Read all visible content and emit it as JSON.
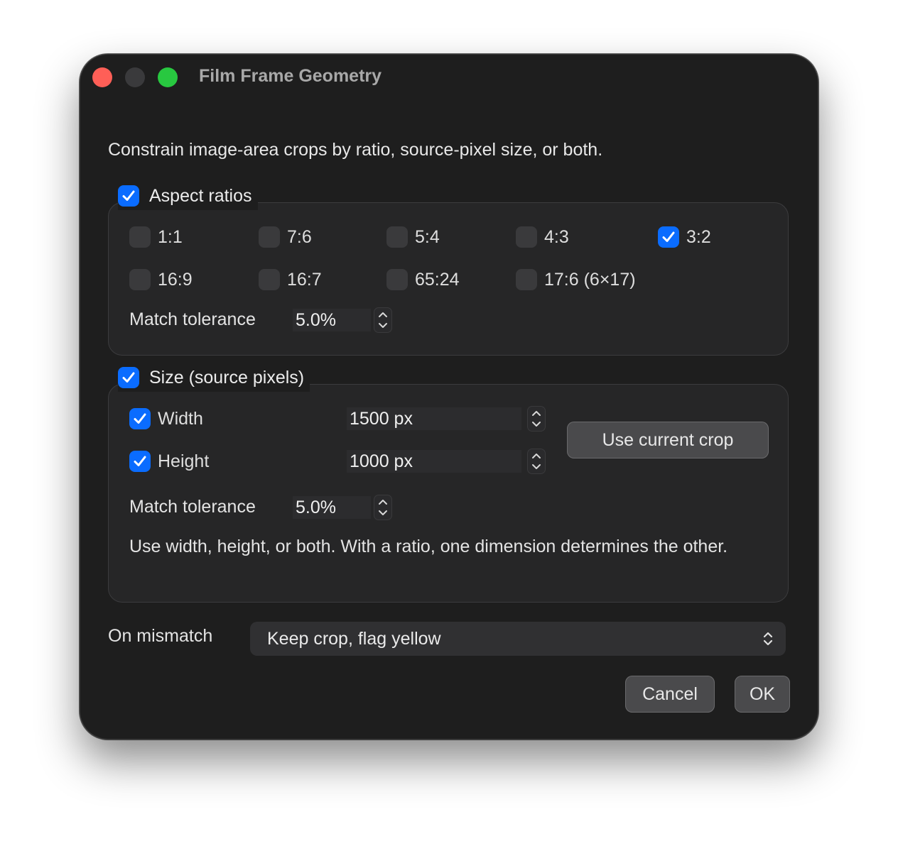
{
  "window": {
    "title": "Film Frame Geometry",
    "description": "Constrain image-area crops by ratio, source-pixel size, or both."
  },
  "aspect": {
    "label": "Aspect ratios",
    "enabled": true,
    "ratios": [
      {
        "label": "1:1",
        "checked": false
      },
      {
        "label": "7:6",
        "checked": false
      },
      {
        "label": "5:4",
        "checked": false
      },
      {
        "label": "4:3",
        "checked": false
      },
      {
        "label": "3:2",
        "checked": true
      },
      {
        "label": "16:9",
        "checked": false
      },
      {
        "label": "16:7",
        "checked": false
      },
      {
        "label": "65:24",
        "checked": false
      },
      {
        "label": "17:6 (6×17)",
        "checked": false
      }
    ],
    "tolerance_label": "Match tolerance",
    "tolerance_value": "5.0%"
  },
  "size": {
    "label": "Size (source pixels)",
    "enabled": true,
    "width_label": "Width",
    "width_checked": true,
    "width_value": "1500 px",
    "height_label": "Height",
    "height_checked": true,
    "height_value": "1000 px",
    "use_current_label": "Use current crop",
    "tolerance_label": "Match tolerance",
    "tolerance_value": "5.0%",
    "note": "Use width, height, or both. With a ratio, one dimension determines the other."
  },
  "mismatch": {
    "label": "On mismatch",
    "value": "Keep crop, flag yellow"
  },
  "buttons": {
    "cancel": "Cancel",
    "ok": "OK"
  },
  "colors": {
    "accent": "#0a6cff",
    "close": "#ff5f57",
    "zoom": "#28c840"
  }
}
